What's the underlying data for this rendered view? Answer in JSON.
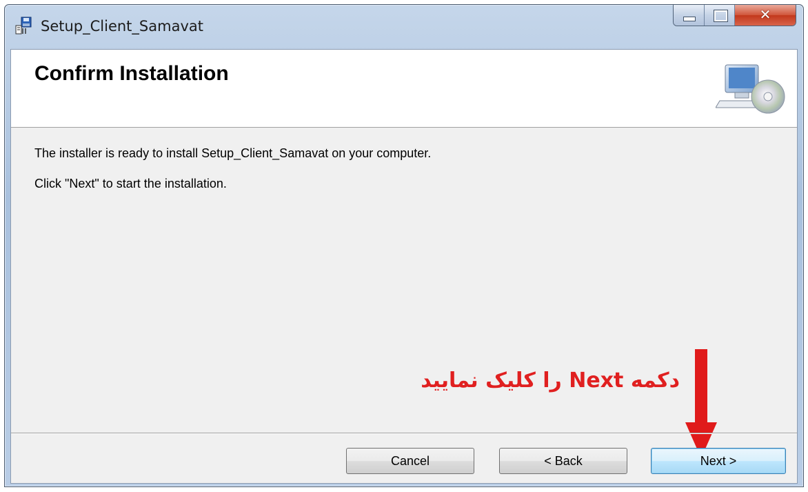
{
  "window": {
    "title": "Setup_Client_Samavat",
    "caption_icons": [
      "minimize-icon",
      "maximize-icon",
      "close-icon"
    ],
    "close_glyph": "✕"
  },
  "banner": {
    "title": "Confirm Installation",
    "icon": "computer-cd-icon"
  },
  "body": {
    "line1": "The installer is ready to install Setup_Client_Samavat on your computer.",
    "line2": "Click \"Next\" to start the installation."
  },
  "annotation": {
    "text": "دکمه Next را کلیک نمایید",
    "color": "#e02020",
    "arrow_icon": "down-arrow-icon"
  },
  "buttons": {
    "cancel": "Cancel",
    "back": "< Back",
    "next": "Next >"
  },
  "colors": {
    "titlebar": "#b9cde6",
    "client_bg": "#f0f0f0",
    "close_button": "#c2381c",
    "next_button_border": "#3c7fb1"
  }
}
